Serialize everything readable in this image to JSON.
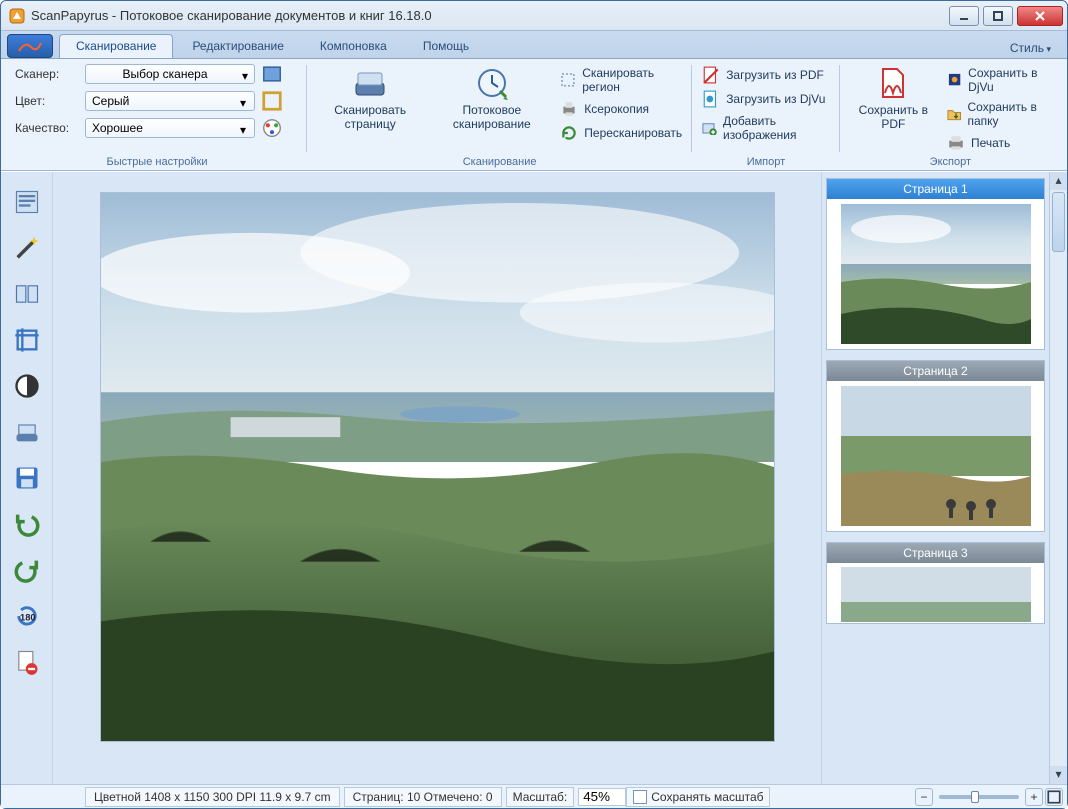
{
  "window": {
    "title": "ScanPapyrus - Потоковое сканирование документов и книг 16.18.0"
  },
  "tabs": {
    "style": "Стиль",
    "items": [
      "Сканирование",
      "Редактирование",
      "Компоновка",
      "Помощь"
    ],
    "active_index": 0
  },
  "ribbon": {
    "quick": {
      "scanner_label": "Сканер:",
      "scanner_value": "Выбор сканера",
      "color_label": "Цвет:",
      "color_value": "Серый",
      "quality_label": "Качество:",
      "quality_value": "Хорошее",
      "group_label": "Быстрые настройки"
    },
    "scan": {
      "scan_page": "Сканировать страницу",
      "stream_scan": "Потоковое сканирование",
      "scan_region": "Сканировать регион",
      "xerocopy": "Ксерокопия",
      "rescan": "Пересканировать",
      "group_label": "Сканирование"
    },
    "import": {
      "load_pdf": "Загрузить из PDF",
      "load_djvu": "Загрузить из DjVu",
      "add_images": "Добавить изображения",
      "group_label": "Импорт"
    },
    "export": {
      "save_pdf": "Сохранить в PDF",
      "save_djvu": "Сохранить в DjVu",
      "save_folder": "Сохранить в папку",
      "print": "Печать",
      "group_label": "Экспорт"
    }
  },
  "pages": [
    {
      "label": "Страница 1",
      "active": true
    },
    {
      "label": "Страница 2",
      "active": false
    },
    {
      "label": "Страница 3",
      "active": false
    }
  ],
  "status": {
    "info": "Цветной  1408 x 1150  300 DPI  11.9 x 9.7 cm",
    "pages": "Страниц: 10  Отмечено: 0",
    "zoom_label": "Масштаб:",
    "zoom_value": "45%",
    "keep_zoom": "Сохранять масштаб"
  }
}
